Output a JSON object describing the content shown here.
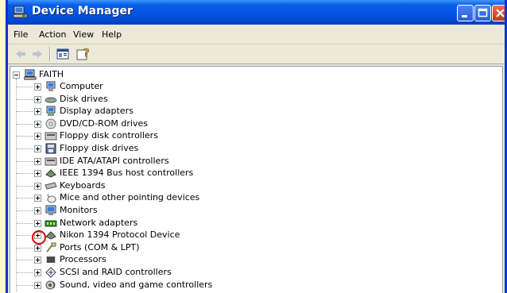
{
  "window": {
    "title": "Device Manager"
  },
  "menu": [
    "File",
    "Action",
    "View",
    "Help"
  ],
  "toolbar": {
    "buttons": [
      "back-arrow-icon",
      "forward-arrow-icon",
      "properties-icon",
      "help-icon"
    ]
  },
  "tree": {
    "root_label": "FAITH",
    "children": [
      {
        "label": "Computer",
        "icon": "computer-icon"
      },
      {
        "label": "Disk drives",
        "icon": "disk-drive-icon"
      },
      {
        "label": "Display adapters",
        "icon": "display-adapter-icon"
      },
      {
        "label": "DVD/CD-ROM drives",
        "icon": "cdrom-icon"
      },
      {
        "label": "Floppy disk controllers",
        "icon": "floppy-controller-icon"
      },
      {
        "label": "Floppy disk drives",
        "icon": "floppy-drive-icon"
      },
      {
        "label": "IDE ATA/ATAPI controllers",
        "icon": "ide-controller-icon"
      },
      {
        "label": "IEEE 1394 Bus host controllers",
        "icon": "ieee1394-icon"
      },
      {
        "label": "Keyboards",
        "icon": "keyboard-icon"
      },
      {
        "label": "Mice and other pointing devices",
        "icon": "mouse-icon"
      },
      {
        "label": "Monitors",
        "icon": "monitor-icon"
      },
      {
        "label": "Network adapters",
        "icon": "network-adapter-icon"
      },
      {
        "label": "Nikon 1394 Protocol Device",
        "icon": "nikon-device-icon"
      },
      {
        "label": "Ports (COM & LPT)",
        "icon": "ports-icon"
      },
      {
        "label": "Processors",
        "icon": "processor-icon"
      },
      {
        "label": "SCSI and RAID controllers",
        "icon": "scsi-icon"
      },
      {
        "label": "Sound, video and game controllers",
        "icon": "sound-icon"
      }
    ]
  },
  "colors": {
    "title_blue": "#0554e3",
    "highlight_red": "#e00000",
    "background_yellow": "#fdf9c8"
  }
}
